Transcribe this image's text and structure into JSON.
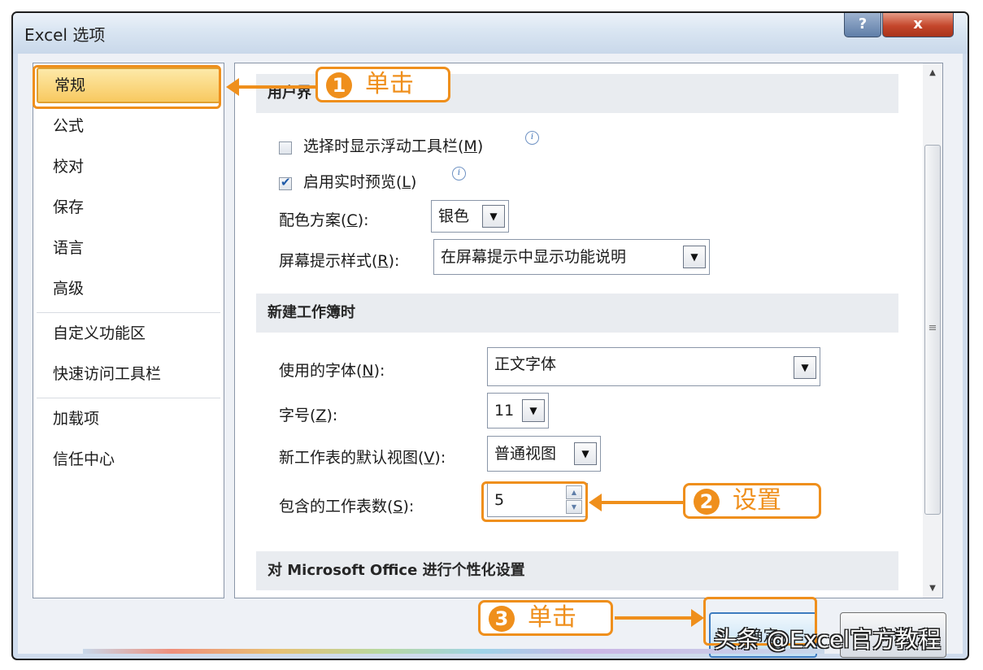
{
  "window": {
    "title": "Excel 选项",
    "help_label": "?",
    "close_label": "x"
  },
  "nav": {
    "items": [
      {
        "label": "常规",
        "selected": true
      },
      {
        "label": "公式"
      },
      {
        "label": "校对"
      },
      {
        "label": "保存"
      },
      {
        "label": "语言"
      },
      {
        "label": "高级"
      },
      {
        "label": "自定义功能区"
      },
      {
        "label": "快速访问工具栏"
      },
      {
        "label": "加载项"
      },
      {
        "label": "信任中心"
      }
    ]
  },
  "sections": {
    "ui": {
      "heading": "用户界",
      "mini_toolbar_label": "选择时显示浮动工具栏(",
      "mini_toolbar_key": "M",
      "mini_toolbar_checked": false,
      "live_preview_label": "启用实时预览(",
      "live_preview_key": "L",
      "live_preview_checked": true,
      "color_scheme_label": "配色方案(",
      "color_scheme_key": "C",
      "color_scheme_value": "银色",
      "screentip_label": "屏幕提示样式(",
      "screentip_key": "R",
      "screentip_value": "在屏幕提示中显示功能说明"
    },
    "new_workbook": {
      "heading": "新建工作簿时",
      "font_label": "使用的字体(",
      "font_key": "N",
      "font_value": "正文字体",
      "size_label": "字号(",
      "size_key": "Z",
      "size_value": "11",
      "view_label": "新工作表的默认视图(",
      "view_key": "V",
      "view_value": "普通视图",
      "sheets_label": "包含的工作表数(",
      "sheets_key": "S",
      "sheets_value": "5"
    },
    "personalize": {
      "heading": "对 Microsoft Office 进行个性化设置"
    }
  },
  "buttons": {
    "ok": "确定",
    "cancel": "取消"
  },
  "annotations": {
    "callout1": {
      "num": "1",
      "text": "单击"
    },
    "callout2": {
      "num": "2",
      "text": "设置"
    },
    "callout3": {
      "num": "3",
      "text": "单击"
    },
    "color": "#ef8f1c"
  },
  "watermark": "头条 @Excel官方教程"
}
